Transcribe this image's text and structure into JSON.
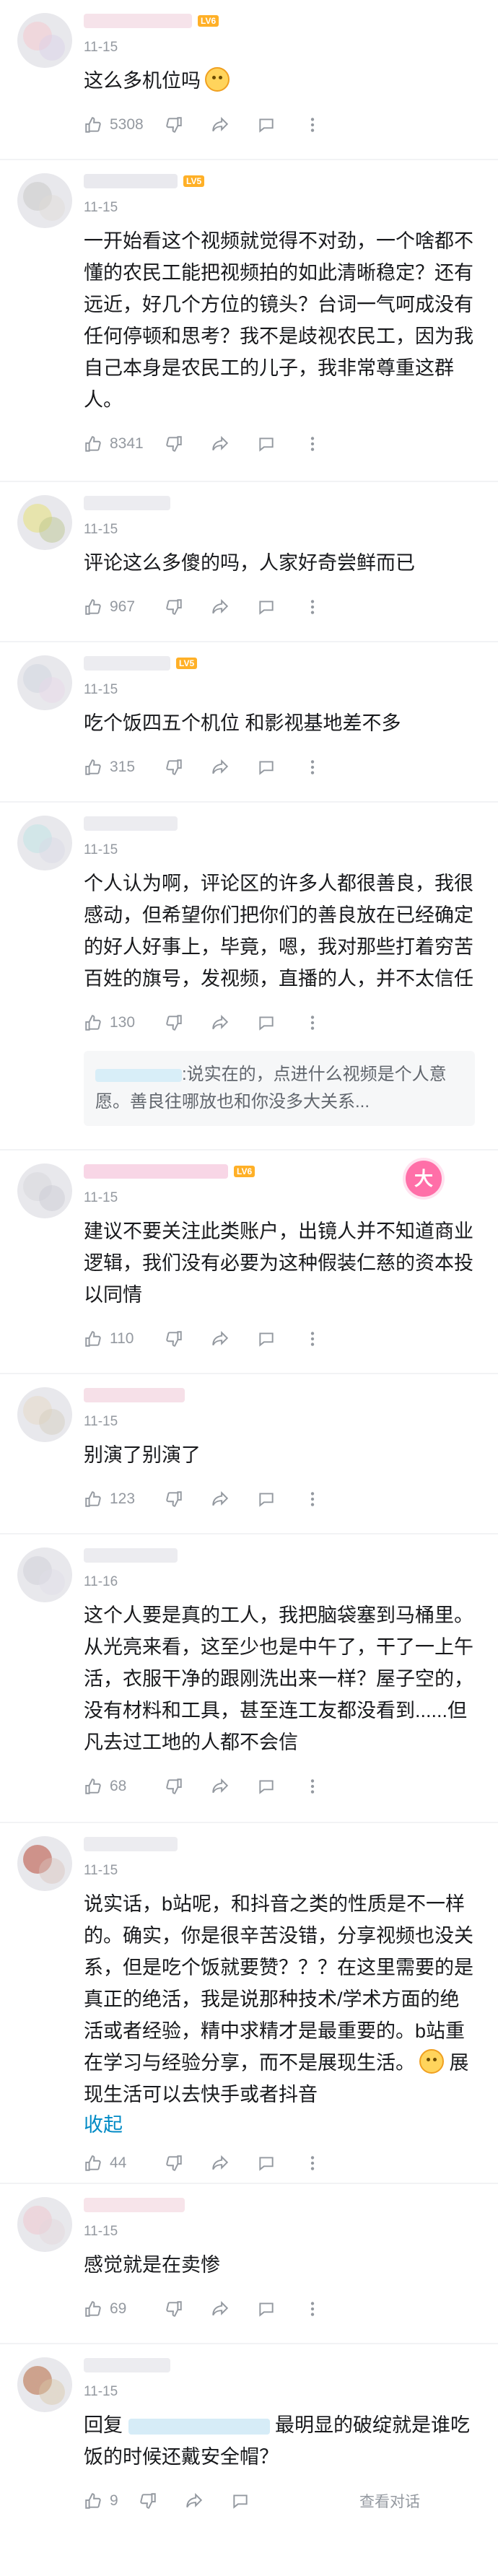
{
  "colors": {
    "link": "#008ac5",
    "meta": "#9499a0",
    "level_badge": "#ffb027"
  },
  "comments": [
    {
      "date": "11-15",
      "text": "这么多机位吗",
      "likes": "5308",
      "emoji": "thinking-emoji"
    },
    {
      "date": "11-15",
      "text": "一开始看这个视频就觉得不对劲，一个啥都不懂的农民工能把视频拍的如此清晰稳定？还有远近，好几个方位的镜头？台词一气呵成没有任何停顿和思考？我不是歧视农民工，因为我自己本身是农民工的儿子，我非常尊重这群人。",
      "likes": "8341"
    },
    {
      "date": "11-15",
      "text": "评论这么多傻的吗，人家好奇尝鲜而已",
      "likes": "967"
    },
    {
      "date": "11-15",
      "text": "吃个饭四五个机位 和影视基地差不多",
      "likes": "315"
    },
    {
      "date": "11-15",
      "text": "个人认为啊，评论区的许多人都很善良，我很感动，但希望你们把你们的善良放在已经确定的好人好事上，毕竟，嗯，我对那些打着穷苦百姓的旗号，发视频，直播的人，并不太信任",
      "likes": "130",
      "reply_preview": ":说实在的，点进什么视频是个人意愿。善良往哪放也和你没多大关系..."
    },
    {
      "date": "11-15",
      "text": "建议不要关注此类账户，出镜人并不知道商业逻辑，我们没有必要为这种假装仁慈的资本投以同情",
      "likes": "110",
      "badge": "大"
    },
    {
      "date": "11-15",
      "text": "别演了别演了",
      "likes": "123"
    },
    {
      "date": "11-16",
      "text": "这个人要是真的工人，我把脑袋塞到马桶里。从光亮来看，这至少也是中午了，干了一上午活，衣服干净的跟刚洗出来一样？屋子空的，没有材料和工具，甚至连工友都没看到......但凡去过工地的人都不会信",
      "likes": "68"
    },
    {
      "date": "11-15",
      "text": "说实话，b站呢，和抖音之类的性质是不一样的。确实，你是很辛苦没错，分享视频也没关系，但是吃个饭就要赞？？？在这里需要的是真正的绝活，我是说那种技术/学术方面的绝活或者经验，精中求精才是最重要的。b站重在学习与经验分享，而不是展现生活。",
      "text_after_emoji": "展现生活可以去快手或者抖音",
      "collapse_label": "收起",
      "likes": "44",
      "emoji": "thinking-emoji"
    },
    {
      "date": "11-15",
      "text": "感觉就是在卖惨",
      "likes": "69"
    },
    {
      "date": "11-15",
      "reply_prefix": "回复",
      "text": "最明显的破绽就是谁吃饭的时候还戴安全帽？",
      "likes": "9",
      "view_dialog_label": "查看对话"
    }
  ]
}
